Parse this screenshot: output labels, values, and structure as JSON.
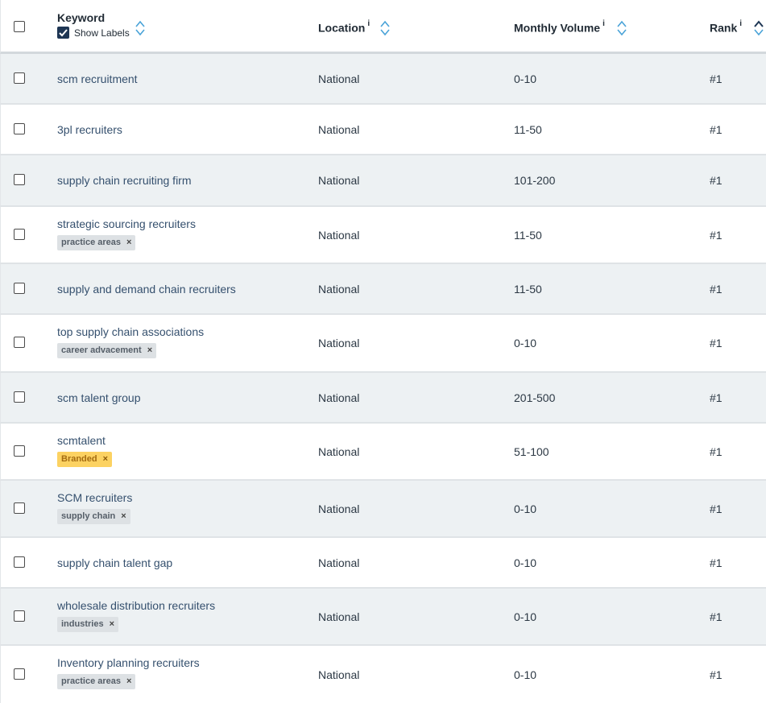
{
  "header": {
    "keyword": "Keyword",
    "show_labels": "Show Labels",
    "location": "Location",
    "monthly_volume": "Monthly Volume",
    "rank": "Rank",
    "info_glyph": "i"
  },
  "rows": [
    {
      "keyword": "scm recruitment",
      "location": "National",
      "volume": "0-10",
      "rank": "#1"
    },
    {
      "keyword": "3pl recruiters",
      "location": "National",
      "volume": "11-50",
      "rank": "#1"
    },
    {
      "keyword": "supply chain recruiting firm",
      "location": "National",
      "volume": "101-200",
      "rank": "#1"
    },
    {
      "keyword": "strategic sourcing recruiters",
      "tag": "practice areas",
      "location": "National",
      "volume": "11-50",
      "rank": "#1"
    },
    {
      "keyword": "supply and demand chain recruiters",
      "location": "National",
      "volume": "11-50",
      "rank": "#1"
    },
    {
      "keyword": "top supply chain associations",
      "tag": "career advacement",
      "location": "National",
      "volume": "0-10",
      "rank": "#1"
    },
    {
      "keyword": "scm talent group",
      "location": "National",
      "volume": "201-500",
      "rank": "#1"
    },
    {
      "keyword": "scmtalent",
      "tag": "Branded",
      "location": "National",
      "volume": "51-100",
      "rank": "#1"
    },
    {
      "keyword": "SCM recruiters",
      "tag": "supply chain",
      "location": "National",
      "volume": "0-10",
      "rank": "#1"
    },
    {
      "keyword": "supply chain talent gap",
      "location": "National",
      "volume": "0-10",
      "rank": "#1"
    },
    {
      "keyword": "wholesale distribution recruiters",
      "tag": "industries",
      "location": "National",
      "volume": "0-10",
      "rank": "#1"
    },
    {
      "keyword": "Inventory planning recruiters",
      "tag": "practice areas",
      "location": "National",
      "volume": "0-10",
      "rank": "#1"
    }
  ],
  "colors": {
    "header_text": "#222c36",
    "keyword_link": "#35506e",
    "row_alt": "#edf1f3",
    "tag_bg": "#dde1e4",
    "branded_bg": "#fcd262",
    "sort_icon": "#4aa3d8",
    "checkbox_checked": "#1e3654"
  },
  "icons": {
    "sort": "sort-updown-icon",
    "remove_tag": "close-icon",
    "checkbox": "checkbox-icon"
  }
}
